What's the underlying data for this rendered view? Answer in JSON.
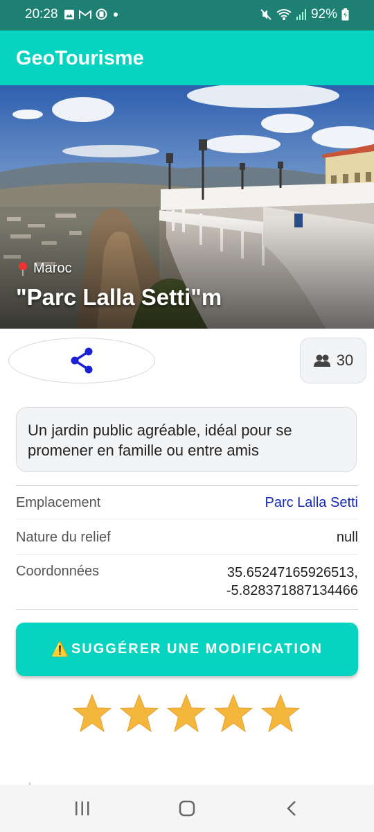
{
  "status_bar": {
    "time": "20:28",
    "battery": "92%",
    "icons": [
      "image-icon",
      "gmail-icon",
      "notification-icon",
      "dot-icon",
      "mute-icon",
      "wifi-icon",
      "signal-icon",
      "battery-icon"
    ]
  },
  "app_bar": {
    "title": "GeoTourisme"
  },
  "hero": {
    "country": "Maroc",
    "place_name": "\"Parc Lalla Setti\"m"
  },
  "actions": {
    "share_icon": "share-icon",
    "visitors_icon": "group-icon",
    "visitors_count": "30"
  },
  "description": "Un jardin public agréable, idéal pour se promener en famille ou entre amis",
  "details": {
    "location": {
      "label": "Emplacement",
      "value": "Parc Lalla Setti"
    },
    "relief": {
      "label": "Nature du relief",
      "value": "null"
    },
    "coordinates": {
      "label": "Coordonnées",
      "line1": "35.65247165926513,",
      "line2": "-5.828371887134466"
    }
  },
  "suggest_button": {
    "icon": "⚠️",
    "label": "SUGGÉRER UNE MODIFICATION"
  },
  "rating": {
    "value": 5,
    "max": 5
  },
  "colors": {
    "accent": "#06d4c0",
    "status_bar": "#1e7f73",
    "link": "#1428b8",
    "star": "#f5b63c"
  }
}
